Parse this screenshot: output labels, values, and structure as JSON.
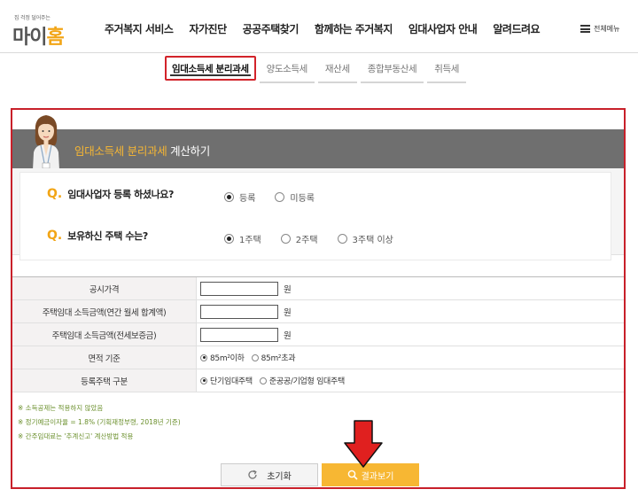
{
  "header": {
    "logo_tagline": "집 걱정 덜어주는",
    "logo_main": "마이",
    "logo_accent": "홈",
    "nav": [
      "주거복지 서비스",
      "자가진단",
      "공공주택찾기",
      "함께하는 주거복지",
      "임대사업자 안내",
      "알려드려요"
    ],
    "all_menu_label": "전체메뉴"
  },
  "tabs": [
    {
      "label": "임대소득세 분리과세",
      "active": true
    },
    {
      "label": "양도소득세",
      "active": false
    },
    {
      "label": "재산세",
      "active": false
    },
    {
      "label": "종합부동산세",
      "active": false
    },
    {
      "label": "취득세",
      "active": false
    }
  ],
  "calculator": {
    "title_highlight": "임대소득세 분리과세",
    "title_suffix": " 계산하기",
    "questions": [
      {
        "mark": "Q.",
        "text": "임대사업자 등록 하셨나요?",
        "options": [
          {
            "label": "등록",
            "selected": true
          },
          {
            "label": "미등록",
            "selected": false
          }
        ]
      },
      {
        "mark": "Q.",
        "text": "보유하신 주택 수는?",
        "options": [
          {
            "label": "1주택",
            "selected": true
          },
          {
            "label": "2주택",
            "selected": false
          },
          {
            "label": "3주택 이상",
            "selected": false
          }
        ]
      }
    ],
    "form_rows": [
      {
        "label": "공시가격",
        "value": "",
        "unit": "원"
      },
      {
        "label": "주택임대 소득금액(연간 월세 합계액)",
        "value": "",
        "unit": "원"
      },
      {
        "label": "주택임대 소득금액(전세보증금)",
        "value": "",
        "unit": "원"
      }
    ],
    "area_row": {
      "label": "면적 기준",
      "options": [
        {
          "label": "85m²이하",
          "selected": true
        },
        {
          "label": "85m²초과",
          "selected": false
        }
      ]
    },
    "housing_type_row": {
      "label": "등록주택 구분",
      "options": [
        {
          "label": "단기임대주택",
          "selected": true
        },
        {
          "label": "준공공/기업형 임대주택",
          "selected": false
        }
      ]
    },
    "notes": [
      "※ 소득공제는 적용하지 않았음",
      "※ 정기예금이자율 = 1.8% (기획재정부령, 2018년 기준)",
      "※ 간주임대료는 '추계신고' 계산방법 적용"
    ],
    "reset_label": "초기화",
    "result_label": "결과보기"
  },
  "colors": {
    "accent": "#f7b733",
    "annotation_red": "#d2232a",
    "title_bar": "#6f6f6f",
    "note_green": "#6a8f2b"
  }
}
